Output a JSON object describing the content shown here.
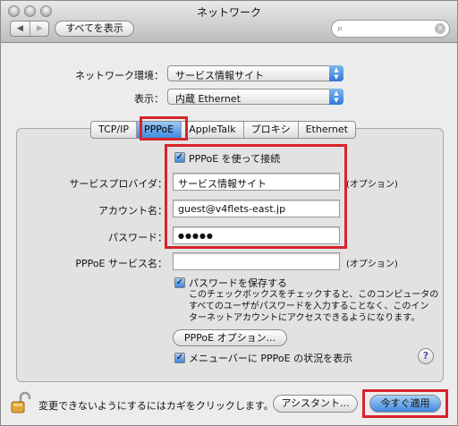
{
  "window": {
    "title": "ネットワーク",
    "show_all": "すべてを表示"
  },
  "environment": {
    "label": "ネットワーク環境：",
    "value": "サービス情報サイト"
  },
  "show": {
    "label": "表示：",
    "value": "内蔵 Ethernet"
  },
  "tabs": [
    {
      "label": "TCP/IP",
      "selected": false
    },
    {
      "label": "PPPoE",
      "selected": true
    },
    {
      "label": "AppleTalk",
      "selected": false
    },
    {
      "label": "プロキシ",
      "selected": false
    },
    {
      "label": "Ethernet",
      "selected": false
    }
  ],
  "pppoe": {
    "use_checkbox_label": "PPPoE を使って接続",
    "use_checked": true,
    "provider_label": "サービスプロバイダ：",
    "provider_value": "サービス情報サイト",
    "account_label": "アカウント名：",
    "account_value": "guest@v4flets-east.jp",
    "password_label": "パスワード：",
    "password_value": "●●●●●",
    "service_name_label": "PPPoE サービス名：",
    "service_name_value": "",
    "optional": "(オプション)",
    "save_password_label": "パスワードを保存する",
    "save_password_checked": true,
    "save_password_note": [
      "このチェックボックスをチェックすると、このコンピュータの",
      "すべてのユーザがパスワードを入力することなく、このイン",
      "ターネットアカウントにアクセスできるようになります。"
    ],
    "options_button": "PPPoE オプション...",
    "menu_status_label": "メニューバーに PPPoE の状況を表示",
    "menu_status_checked": true
  },
  "footer": {
    "lock_text": "変更できないようにするにはカギをクリックします。",
    "assistant_button": "アシスタント...",
    "apply_button": "今すぐ適用"
  },
  "icons": {
    "close": "close-icon",
    "minimize": "minimize-icon",
    "zoom": "zoom-icon",
    "back": "back-arrow-icon",
    "forward": "forward-arrow-icon",
    "search": "search-icon",
    "clear": "clear-icon",
    "help": "help-icon",
    "lock": "lock-open-icon"
  },
  "colors": {
    "highlight": "#d8232a",
    "accent": "#3f88dd"
  }
}
